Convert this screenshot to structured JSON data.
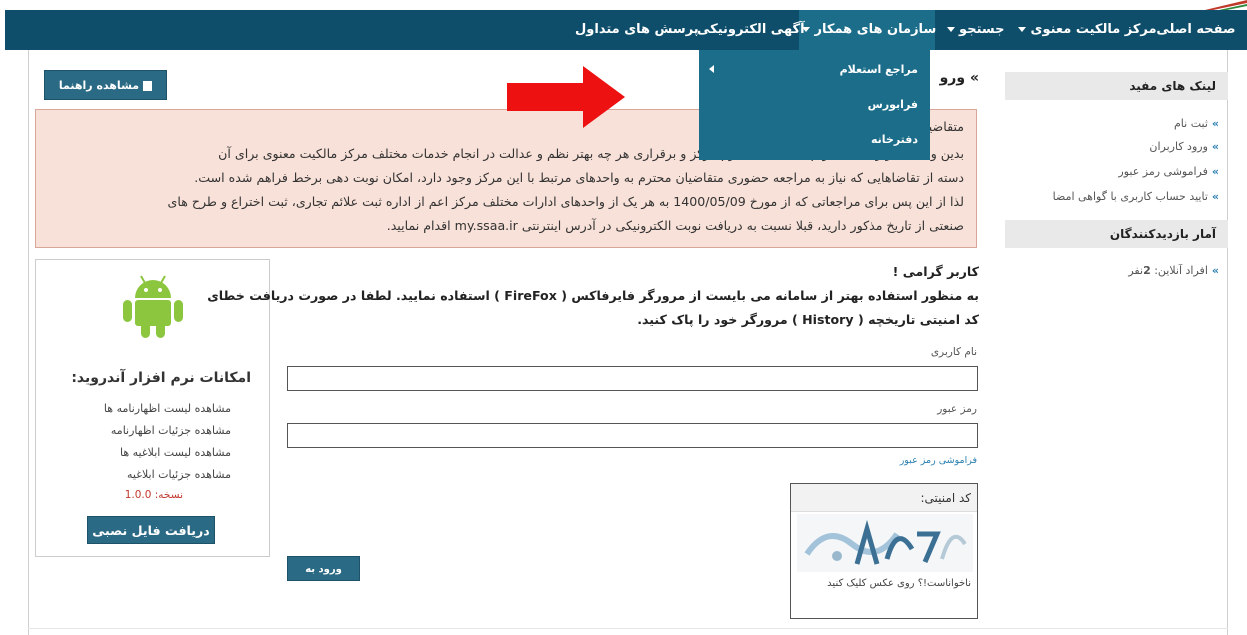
{
  "nav": {
    "items": [
      {
        "label": "صفحه اصلی",
        "caret": false
      },
      {
        "label": "مرکز مالکیت معنوی",
        "caret": true
      },
      {
        "label": "جستجو",
        "caret": true
      },
      {
        "label": "سازمان های همکار",
        "caret": true
      },
      {
        "label": "آگهی الکترونیکی",
        "caret": false
      },
      {
        "label": "پرسش های متداول",
        "caret": false
      }
    ],
    "active_item": "سازمان های همکار"
  },
  "dropdown": {
    "items": [
      "مراجع استعلام",
      "فرابورس",
      "دفترخانه"
    ]
  },
  "sidebar": {
    "links_heading": "لینک های مفید",
    "links": [
      "ثبت نام",
      "ورود کاربران",
      "فراموشی رمز عبور",
      "تایید حساب کاربری با گواهی امضا"
    ],
    "stats_heading": "آمار بازدیدکنندگان",
    "online_label": "افراد آنلاین:",
    "online_count": "2",
    "online_unit": "نفر"
  },
  "guide_button": "مشاهده راهنما",
  "login_title": "» ورو",
  "notice": {
    "lines": [
      "متقاضیان",
      "بدین وسیله، در راستای تکریم متقاضیان محترم مرکز و برقراری هر چه بهتر نظم و عدالت در انجام خدمات مختلف مرکز مالکیت معنوی برای آن",
      "دسته از تقاضاهایی که نیاز به مراجعه حضوری متقاضیان محترم به واحدهای مرتبط با این مرکز وجود دارد، امکان نوبت دهی برخط فراهم شده است.",
      "لذا از این پس برای مراجعاتی که از مورخ 1400/05/09 به هر یک از واحدهای ادارات مختلف مرکز اعم از اداره ثبت علائم تجاری، ثبت اختراع و طرح های",
      "صنعتی از تاریخ مذکور دارید، قبلا نسبت به دریافت نوبت الکترونیکی در آدرس اینترنتی my.ssaa.ir اقدام نمایید."
    ]
  },
  "login": {
    "greeting": "کاربر گرامی !",
    "message_line1": "به منظور استفاده بهتر از سامانه می بایست از مرورگر فایرفاکس ( FireFox ) استفاده نمایید. لطفا در صورت دریافت خطای",
    "message_line2": "کد امنیتی تاریخچه ( History ) مرورگر خود را پاک کنید.",
    "username_label": "نام کاربری",
    "username_value": "",
    "password_label": "رمز عبور",
    "password_value": "",
    "forgot_label": "فراموشی رمز عبور",
    "captcha_label": "کد امنیتی:",
    "captcha_hint": "ناخواناست!؟ روی عکس کلیک کنید",
    "submit_label": "ورود به سامانه"
  },
  "android": {
    "heading": "امکانات نرم افزار آندروید:",
    "features": [
      "مشاهده لیست اظهارنامه ها",
      "مشاهده جزئیات اظهارنامه",
      "مشاهده لیست ابلاغیه ها",
      "مشاهده جزئیات ابلاغیه"
    ],
    "version": "نسخه: 1.0.0",
    "download_label": "دریافت فایل نصبی"
  },
  "colors": {
    "nav_bg": "#0e4e6b",
    "nav_active": "#1b6d8a",
    "button": "#2b6a84",
    "notice_bg": "#f8e1d8",
    "notice_border": "#d9a79a",
    "arrow": "#ee1111",
    "android_green": "#8cc63f"
  }
}
